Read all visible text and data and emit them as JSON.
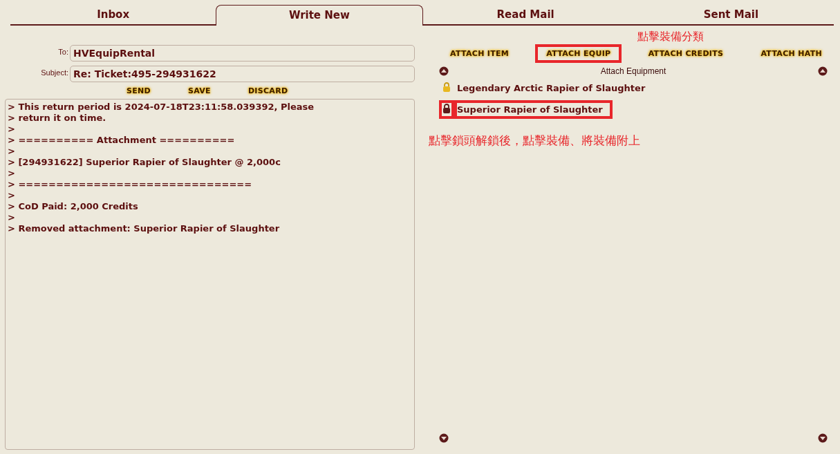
{
  "tabs": [
    {
      "label": "Inbox",
      "selected": false
    },
    {
      "label": "Write New",
      "selected": true
    },
    {
      "label": "Read Mail",
      "selected": false
    },
    {
      "label": "Sent Mail",
      "selected": false
    }
  ],
  "compose": {
    "to_label": "To:",
    "to": "HVEquipRental",
    "subject_label": "Subject:",
    "subject": "Re: Ticket:495-294931622",
    "buttons": [
      "SEND",
      "SAVE",
      "DISCARD"
    ],
    "body": [
      "> This return period is 2024-07-18T23:11:58.039392, Please",
      "> return it on time.",
      ">",
      "> ========== Attachment ==========",
      ">",
      "> [294931622] Superior Rapier of Slaughter @ 2,000c",
      ">",
      "> ===============================",
      ">",
      "> CoD Paid: 2,000 Credits",
      ">",
      "> Removed attachment: Superior Rapier of Slaughter"
    ]
  },
  "attach": {
    "category_note": "點擊裝備分類",
    "buttons": [
      {
        "label": "ATTACH ITEM",
        "highlighted": false
      },
      {
        "label": "ATTACH EQUIP",
        "highlighted": true
      },
      {
        "label": "ATTACH CREDITS",
        "highlighted": false
      },
      {
        "label": "ATTACH HATH",
        "highlighted": false
      }
    ],
    "list_title": "Attach Equipment",
    "items": [
      {
        "name": "Legendary Arctic Rapier of Slaughter",
        "locked": true,
        "highlighted": false
      },
      {
        "name": "Superior Rapier of Slaughter",
        "locked": false,
        "highlighted": true
      }
    ],
    "unlock_note": "點擊鎖頭解鎖後，點擊裝備、將裝備附上"
  }
}
